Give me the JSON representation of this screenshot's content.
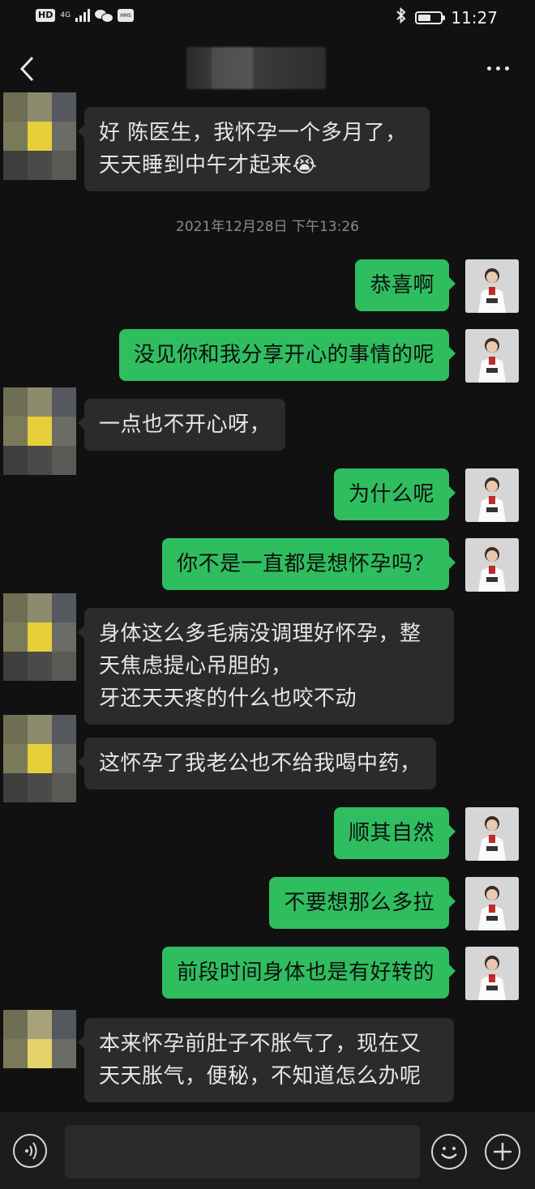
{
  "status_bar": {
    "hd_label": "HD",
    "network_label": "4G",
    "hms_label": "HMS",
    "time": "11:27",
    "battery_level_pct": 55
  },
  "header": {
    "contact_name_redacted": true
  },
  "timestamp": "2021年12月28日 下午13:26",
  "messages": [
    {
      "side": "left",
      "text": "好 陈医生，我怀孕一个多月了，\n天天睡到中午才起来😭"
    },
    {
      "side": "right",
      "text": "恭喜啊"
    },
    {
      "side": "right",
      "text": "没见你和我分享开心的事情的呢"
    },
    {
      "side": "left",
      "text": "一点也不开心呀，"
    },
    {
      "side": "right",
      "text": "为什么呢"
    },
    {
      "side": "right",
      "text": "你不是一直都是想怀孕吗？"
    },
    {
      "side": "left",
      "text": "身体这么多毛病没调理好怀孕，整\n天焦虑提心吊胆的，\n牙还天天疼的什么也咬不动"
    },
    {
      "side": "left",
      "text": "这怀孕了我老公也不给我喝中药，"
    },
    {
      "side": "right",
      "text": "顺其自然"
    },
    {
      "side": "right",
      "text": "不要想那么多拉"
    },
    {
      "side": "right",
      "text": "前段时间身体也是有好转的"
    },
    {
      "side": "left",
      "text": "本来怀孕前肚子不胀气了，现在又\n天天胀气，便秘，不知道怎么办呢"
    }
  ],
  "input": {
    "value": "",
    "placeholder": ""
  },
  "colors": {
    "background": "#111111",
    "incoming_bubble": "#2b2b2b",
    "outgoing_bubble": "#2fbe5f",
    "input_bar": "#1c1c1c"
  }
}
